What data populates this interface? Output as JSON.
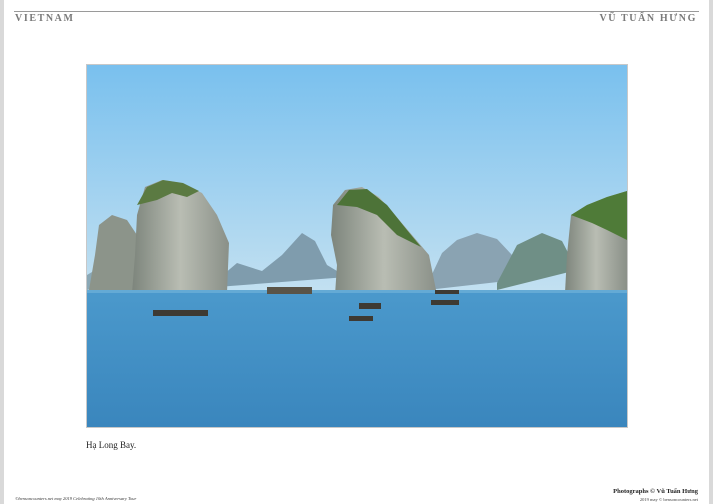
{
  "header": {
    "left": "VIETNAM",
    "right": "VŨ TUẤN HƯNG"
  },
  "photo": {
    "subject": "Hạ Long Bay landscape"
  },
  "caption": "Hạ Long Bay.",
  "footer": {
    "left": "©bensoncounters.net may 2019 Celebrating 10th Anniversary Tour",
    "right_line1": "Photographs © Vũ Tuấn Hưng",
    "right_line2": "2019 may © bensoncounters.net"
  },
  "colors": {
    "sky_top": "#7ec3ee",
    "sky_bottom": "#b9dcf2",
    "water": "#3f8fc7",
    "rock": "#9aa39a",
    "vegetation": "#4f7a3b"
  }
}
